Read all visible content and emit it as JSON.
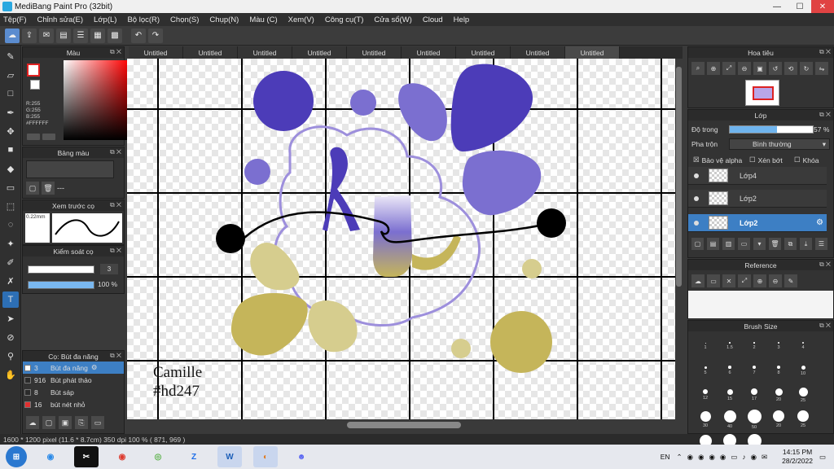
{
  "window": {
    "title": "MediBang Paint Pro (32bit)",
    "controls": [
      "—",
      "☐",
      "✕"
    ]
  },
  "menu": [
    "Tệp(F)",
    "Chỉnh sửa(E)",
    "Lớp(L)",
    "Bộ lọc(R)",
    "Chọn(S)",
    "Chụp(N)",
    "Màu (C)",
    "Xem(V)",
    "Công cụ(T)",
    "Cửa sổ(W)",
    "Cloud",
    "Help"
  ],
  "tabs": [
    "Untitled",
    "Untitled",
    "Untitled",
    "Untitled",
    "Untitled",
    "Untitled",
    "Untitled",
    "Untitled",
    "Untitled"
  ],
  "color_panel": {
    "title": "Màu",
    "rgb": [
      "R:255",
      "G:255",
      "B:255",
      "#FFFFFF"
    ]
  },
  "palette_panel": {
    "title": "Bảng màu",
    "dashes": "---"
  },
  "preview_panel": {
    "title": "Xem trước cọ",
    "size_label": "0.22mm"
  },
  "stabilizer_panel": {
    "title": "Kiểm soát cọ",
    "correction": "3",
    "opacity": "100 %",
    "opacity_fraction": 1.0
  },
  "brush_panel": {
    "title": "Cọ: Bút đa năng",
    "items": [
      {
        "size": "3",
        "name": "Bút đa năng",
        "color": "#ffffff"
      },
      {
        "size": "916",
        "name": "Bút phát thảo",
        "color": "#2b2b2b"
      },
      {
        "size": "8",
        "name": "Bút sáp",
        "color": "#2b2b2b"
      },
      {
        "size": "16",
        "name": "bút nét nhỏ",
        "color": "#e03030"
      }
    ]
  },
  "canvas": {
    "signature_line1": "Camille",
    "signature_line2": "#hd247"
  },
  "status": "1600 * 1200 pixel   (11.6 * 8.7cm)   350 dpi   100 %   ( 871, 969 )",
  "navigator_panel": {
    "title": "Hoa tiêu"
  },
  "layer_panel": {
    "title": "Lớp",
    "opacity_label": "Độ trong",
    "opacity_value": "57 %",
    "opacity_fraction": 0.57,
    "blend_label": "Pha trộn",
    "blend_value": "Bình thường",
    "protect_alpha": "Bảo vệ alpha",
    "clipping": "Xén bớt",
    "lock": "Khóa",
    "layers": [
      "Lớp4",
      "Lớp2",
      "Lớp2"
    ]
  },
  "reference_panel": {
    "title": "Reference"
  },
  "brush_size_panel": {
    "title": "Brush Size",
    "labels": [
      "1",
      "1.5",
      "2",
      "3",
      "4",
      "5",
      "6",
      "7",
      "8",
      "10",
      "12",
      "15",
      "17",
      "20",
      "25",
      "30",
      "40",
      "50",
      "20",
      "25",
      "30",
      "40",
      "50"
    ]
  },
  "taskbar": {
    "language": "EN",
    "time": "14:15 PM",
    "date": "28/2/2022"
  },
  "colors": {
    "accent": "#3d7fc4",
    "purple": "#4c3cb8",
    "lavender": "#7b6fd0",
    "khaki": "#c5b55a",
    "light_khaki": "#d6cd8e"
  }
}
